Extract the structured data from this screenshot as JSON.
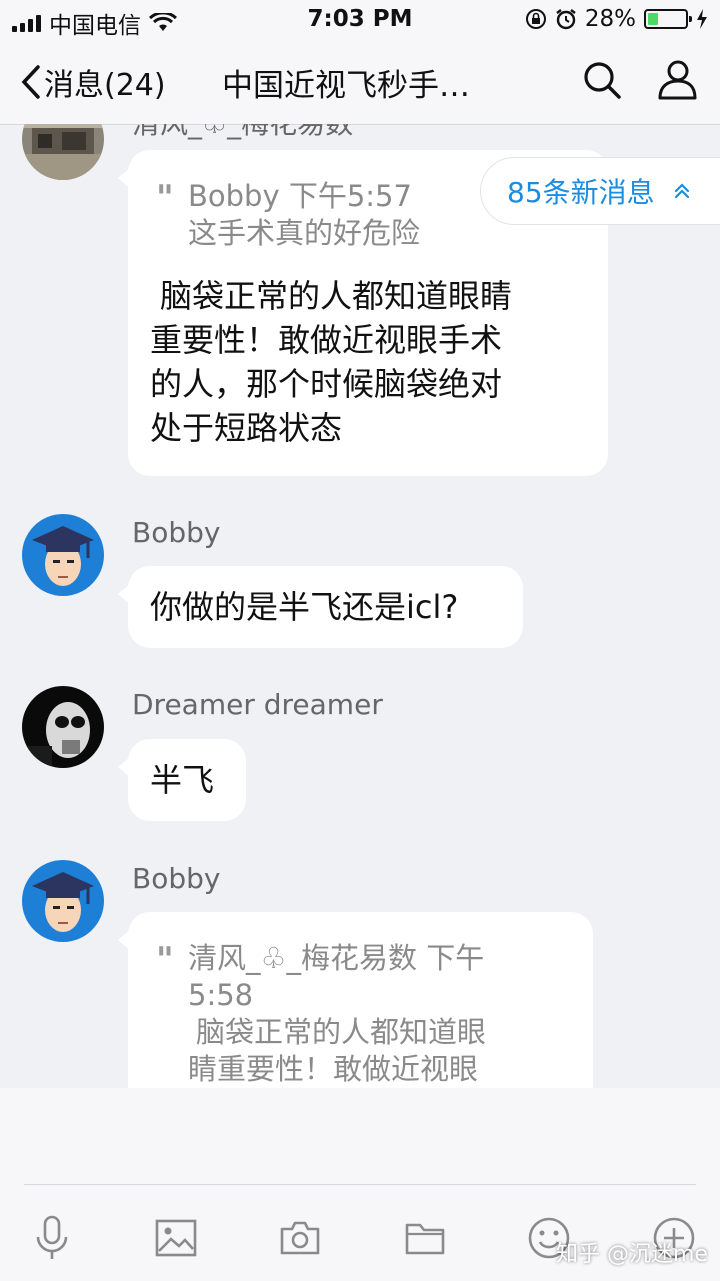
{
  "status_bar": {
    "carrier": "中国电信",
    "time": "7:03 PM",
    "battery_percent_text": "28%",
    "battery_level": 0.28,
    "battery_color": "#4cd964",
    "icons": [
      "signal-icon",
      "wifi-icon",
      "rotation-lock-icon",
      "alarm-icon",
      "battery-icon",
      "charging-icon"
    ]
  },
  "nav": {
    "back_label": "消息(24)",
    "title": "中国近视飞秒手…",
    "icons": [
      "back-chevron-icon",
      "search-icon",
      "group-members-icon"
    ]
  },
  "new_messages": {
    "label": "85条新消息",
    "icon": "double-chevron-up-icon",
    "accent": "#1a8de0"
  },
  "messages": [
    {
      "sender": "清风_♧_梅花易数",
      "quote_header": "Bobby 下午5:57",
      "quote_text": "这手术真的好危险",
      "lines": [
        "脑袋正常的人都知道眼睛",
        "重要性！敢做近视眼手术",
        "的人，那个时候脑袋绝对",
        "处于短路状态"
      ]
    },
    {
      "sender": "Bobby",
      "text": "你做的是半飞还是icl?"
    },
    {
      "sender": "Dreamer dreamer",
      "text": "半飞"
    },
    {
      "sender": "Bobby",
      "quote_header_line1": "清风_♧_梅花易数 下午",
      "quote_header_line2": "5:58",
      "quote_text_line1": "脑袋正常的人都知道眼",
      "quote_text_line2": "睛重要性！敢做近视眼"
    }
  ],
  "toolbar": {
    "icons": [
      "microphone-icon",
      "image-icon",
      "camera-icon",
      "folder-icon",
      "emoji-icon",
      "plus-icon"
    ]
  },
  "watermark": "知乎 @沉迷me"
}
